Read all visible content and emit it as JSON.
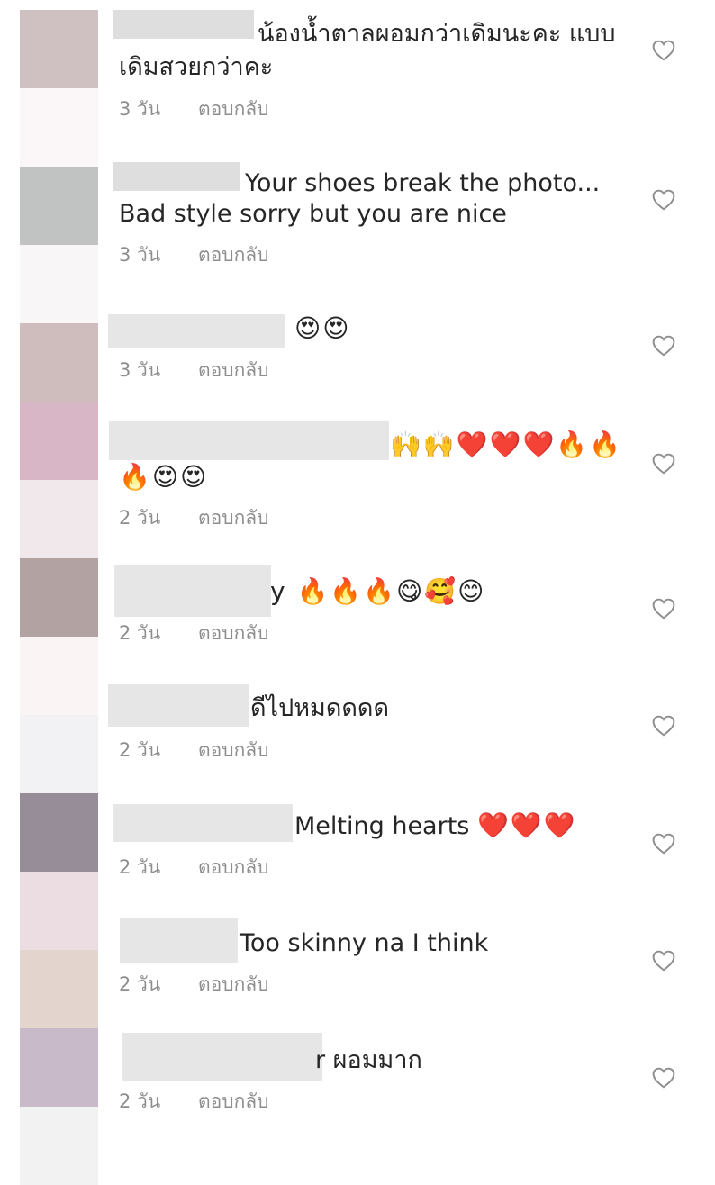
{
  "avatar_colors": [
    "#cfc1c1",
    "#fbf7f8",
    "#c0c3c2",
    "#f8f6f7",
    "#cfbcbd",
    "#d8b6c6",
    "#f0e8eb",
    "#b2a2a1",
    "#fbf4f5",
    "#f2f1f3",
    "#978d98",
    "#ecdde3",
    "#e3d5cd",
    "#c8bac9",
    "#f2f2f2"
  ],
  "comments": [
    {
      "text_line1": "น้องน้ำตาลผอมกว่าเดิมนะคะ แบบ",
      "text_line2": "เดิมสวยกว่าคะ",
      "age": "3 วัน",
      "reply": "ตอบกลับ"
    },
    {
      "text_line1": "Your shoes break the photo...",
      "text_line2": "Bad style sorry but you are nice",
      "age": "3 วัน",
      "reply": "ตอบกลับ"
    },
    {
      "text_line1": "😍😍",
      "age": "3 วัน",
      "reply": "ตอบกลับ"
    },
    {
      "text_line1": "🙌🙌❤️❤️❤️🔥🔥",
      "text_line2": "🔥😍😍",
      "age": "2 วัน",
      "reply": "ตอบกลับ"
    },
    {
      "text_line1": "y 🔥🔥🔥😋🥰😊",
      "age": "2 วัน",
      "reply": "ตอบกลับ"
    },
    {
      "text_line1": "ดีไปหมดดดด",
      "age": "2 วัน",
      "reply": "ตอบกลับ"
    },
    {
      "text_line1": "Melting hearts",
      "emoji": "❤️❤️❤️",
      "age": "2 วัน",
      "reply": "ตอบกลับ"
    },
    {
      "text_line1": "Too skinny na I think",
      "age": "2 วัน",
      "reply": "ตอบกลับ"
    },
    {
      "text_line1": "r ผอมมาก",
      "age": "2 วัน",
      "reply": "ตอบกลับ"
    }
  ]
}
